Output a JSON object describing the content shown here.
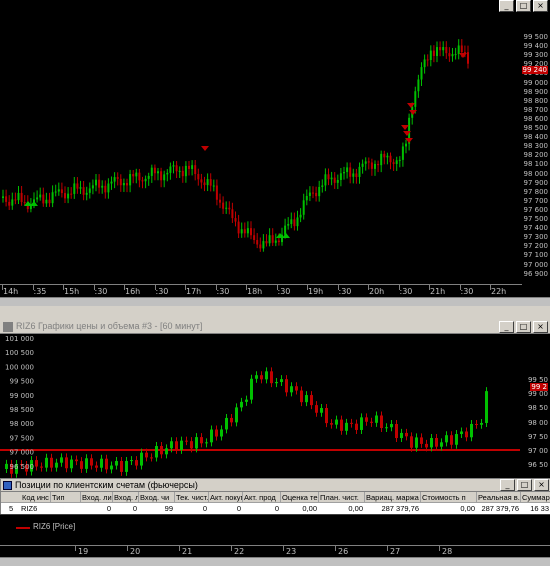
{
  "window_buttons": [
    "_",
    "□",
    "×"
  ],
  "top_chart": {
    "y_labels": [
      "99 500",
      "99 400",
      "99 300",
      "99 200",
      "99 100",
      "99 000",
      "98 900",
      "98 800",
      "98 700",
      "98 600",
      "98 500",
      "98 400",
      "98 300",
      "98 200",
      "98 100",
      "98 000",
      "97 900",
      "97 800",
      "97 700",
      "97 600",
      "97 500",
      "97 400",
      "97 300",
      "97 200",
      "97 100",
      "97 000",
      "96 900"
    ],
    "current_price_label": "99 240",
    "x_labels": [
      "14h",
      ":35",
      "15h",
      ":30",
      "16h",
      ":30",
      "17h",
      ":30",
      "18h",
      ":30",
      "19h",
      ":30",
      "20h",
      ":30",
      "21h",
      ":30",
      "22h"
    ]
  },
  "bottom_chart": {
    "title": "RIZ6 Графики цены и объема #3 - [60 минут]",
    "y_labels": [
      "101 000",
      "100 500",
      "100 000",
      "99 500",
      "99 000",
      "98 500",
      "98 000",
      "97 500",
      "97 000",
      "96 500"
    ],
    "right_labels": [
      "99 50",
      "99 00",
      "98 50",
      "98 00",
      "97 50",
      "97 00",
      "96 50"
    ],
    "current_label": "99 2",
    "level_line": "97 000",
    "legend": "RIZ6 [Price]",
    "x_labels": [
      "19",
      "20",
      "21",
      "22",
      "23",
      "26",
      "27",
      "28"
    ]
  },
  "positions": {
    "title": "Позиции по клиентским счетам (фьючерсы)",
    "columns": [
      "Код инс",
      "Тип",
      "Вход. ли",
      "Вход. л",
      "Вход. чи",
      "Тек. чист.",
      "Акт. покуп",
      "Акт. прод",
      "Оценка те",
      "План. чист.",
      "Вариац. маржа",
      "Стоимость п",
      "Реальная в.м",
      "Суммарн"
    ],
    "row_number": "5",
    "row": [
      "RIZ6",
      "",
      "0",
      "0",
      "99",
      "0",
      "0",
      "0",
      "0,00",
      "0,00",
      "287 379,76",
      "0,00",
      "287 379,76",
      "16 33"
    ]
  },
  "colors": {
    "up": "#00c000",
    "down": "#c00000",
    "level": "#ff0000"
  }
}
